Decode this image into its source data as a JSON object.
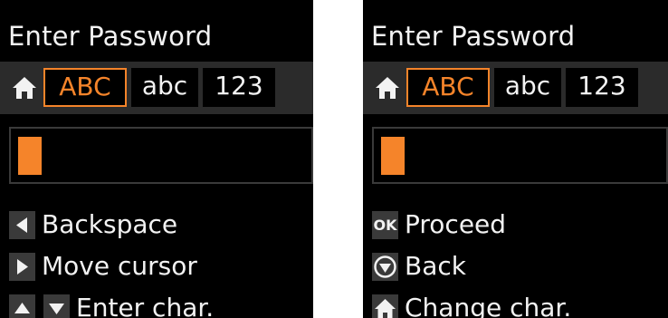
{
  "panels": [
    {
      "title": "Enter Password",
      "tabs": {
        "upper": "ABC",
        "lower": "abc",
        "digits": "123"
      },
      "options": [
        {
          "icon": "arrow-left-icon",
          "label": "Backspace"
        },
        {
          "icon": "arrow-right-icon",
          "label": "Move cursor"
        },
        {
          "icons": [
            "arrow-up-icon",
            "arrow-down-icon"
          ],
          "label": "Enter char."
        }
      ]
    },
    {
      "title": "Enter Password",
      "tabs": {
        "upper": "ABC",
        "lower": "abc",
        "digits": "123"
      },
      "options": [
        {
          "icon": "ok-icon",
          "icon_text": "OK",
          "label": "Proceed"
        },
        {
          "icon": "back-icon",
          "label": "Back"
        },
        {
          "icon": "home-icon",
          "label": "Change char."
        }
      ]
    }
  ],
  "colors": {
    "accent": "#f5842a",
    "background": "#000000",
    "text": "#f2f2f2",
    "bar": "#2b2b2b"
  }
}
